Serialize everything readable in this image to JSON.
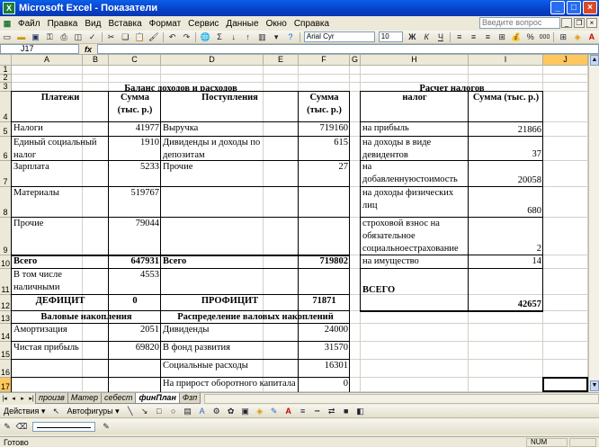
{
  "window": {
    "title": "Microsoft Excel - Показатели",
    "icon": "excel-app-icon"
  },
  "menu": [
    "Файл",
    "Правка",
    "Вид",
    "Вставка",
    "Формат",
    "Сервис",
    "Данные",
    "Окно",
    "Справка"
  ],
  "help_placeholder": "Введите вопрос",
  "toolbar": {
    "font": "Arial Cyr",
    "size": "10",
    "bold": "Ж",
    "italic": "К",
    "underline": "Ч",
    "percent": "%",
    "comma": "000"
  },
  "formula_bar": {
    "name_box": "J17",
    "fx": "fx",
    "value": ""
  },
  "columns": [
    "A",
    "B",
    "C",
    "D",
    "E",
    "F",
    "G",
    "H",
    "I",
    "J"
  ],
  "selected_column": "J",
  "rows": [
    "1",
    "2",
    "3",
    "4",
    "5",
    "6",
    "7",
    "8",
    "9",
    "10",
    "11",
    "12",
    "13",
    "14",
    "15",
    "16",
    "17",
    "18"
  ],
  "selected_row": "17",
  "balance": {
    "title": "Баланс доходов и расходов",
    "payments_header": "Платежи",
    "sum_header_c": "Сумма (тыс. р.)",
    "receipts_header": "Поступления",
    "sum_header_f": "Сумма (тыс. р.)",
    "rows": [
      {
        "a": "Налоги",
        "c": "41977",
        "d": "Выручка",
        "f": "719160"
      },
      {
        "a": "Единый социальный налог",
        "c": "1910",
        "d": "Дивиденды и доходы по депозитам",
        "f": "615"
      },
      {
        "a": "Зарплата",
        "c": "5233",
        "d": "Прочие",
        "f": "27"
      },
      {
        "a": "Материалы",
        "c": "519767",
        "d": "",
        "f": ""
      },
      {
        "a": "Прочие",
        "c": "79044",
        "d": "",
        "f": ""
      }
    ],
    "total_label": "Всего",
    "total_c": "647931",
    "total_d_label": "Всего",
    "total_f": "719802",
    "incl_label": "В том числе наличными",
    "incl_c": "4553",
    "deficit_label": "ДЕФИЦИТ",
    "deficit_value": "0",
    "surplus_label": "ПРОФИЦИТ",
    "surplus_value": "71871"
  },
  "gross": {
    "title": "Валовые накопления",
    "rows": [
      {
        "a": "Амортизация",
        "c": "2051"
      },
      {
        "a": "Чистая прибыль",
        "c": "69820"
      }
    ]
  },
  "distribution": {
    "title": "Распределение валовых накоплений",
    "rows": [
      {
        "d": "Дивиденды",
        "f": "24000"
      },
      {
        "d": "В фонд развития",
        "f": "31570"
      },
      {
        "d": "Социальные расходы",
        "f": "16301"
      },
      {
        "d": "На прирост оборотного капитала",
        "f": "0"
      }
    ]
  },
  "taxes": {
    "title": "Расчет налогов",
    "tax_header": "налог",
    "sum_header": "Сумма (тыс. р.)",
    "rows": [
      {
        "h": "на прибыль",
        "i": "21866"
      },
      {
        "h": "на доходы в виде девидентов",
        "i": "37"
      },
      {
        "h": "на добавленнуюстоимость",
        "i": "20058"
      },
      {
        "h": "на доходы физических лиц",
        "i": "680"
      },
      {
        "h": "строховой взнос на обязательное социальноестрахование",
        "i": "2"
      },
      {
        "h": "на имущество",
        "i": "14"
      }
    ],
    "total_label": "ВСЕГО",
    "total_value": "42657"
  },
  "sheets": [
    "произв",
    "Матер",
    "себест",
    "финПлан",
    "Фзп"
  ],
  "active_sheet": "финПлан",
  "drawing": {
    "actions": "Действия ▾",
    "autoshapes": "Автофигуры ▾"
  },
  "status": {
    "left": "Готово",
    "num": "NUM"
  }
}
